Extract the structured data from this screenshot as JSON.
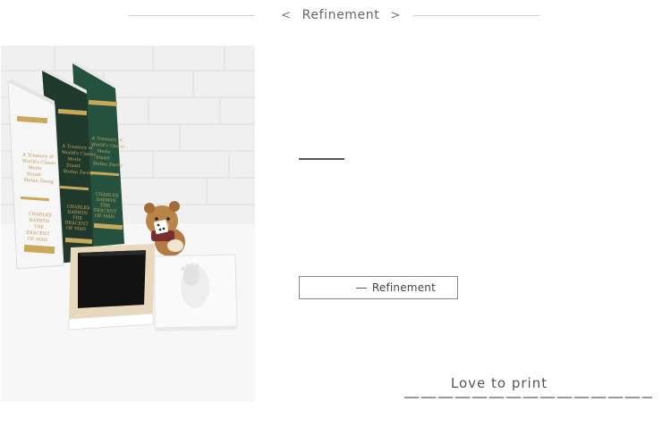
{
  "header": {
    "title": "Refinement",
    "prev_glyph": "<",
    "next_glyph": ">"
  },
  "photo": {
    "books": [
      {
        "cover_color": "#f6f6f6",
        "title_lines": [
          "A Treasury of",
          "World's Classic",
          "Merle",
          "Stuart",
          "Stefan Zweig"
        ],
        "spine_lines": [
          "CHARLES",
          "DARWIN",
          "THE",
          "DESCENT",
          "OF MAN"
        ]
      },
      {
        "cover_color": "#1f3a2c",
        "title_lines": [
          "A Treasury of",
          "World's Classic",
          "Merle",
          "Stuart",
          "Stefan Zweig"
        ],
        "spine_lines": [
          "CHARLES",
          "DARWIN",
          "THE",
          "DESCENT",
          "OF MAN"
        ]
      },
      {
        "cover_color": "#25513f",
        "title_lines": [
          "A Treasury of",
          "World's Classic",
          "Merle",
          "Stuart",
          "Stefan Zweig"
        ],
        "spine_lines": [
          "CHARLES",
          "DARWIN",
          "THE",
          "DESCENT",
          "OF MAN"
        ]
      }
    ]
  },
  "button": {
    "label": "Refinement"
  },
  "tagline": "Love to print",
  "colors": {
    "gold": "#c9a85a",
    "frame_wood": "#e8d9bd",
    "wall": "#f1f1f1",
    "teddy": "#b27b44"
  }
}
